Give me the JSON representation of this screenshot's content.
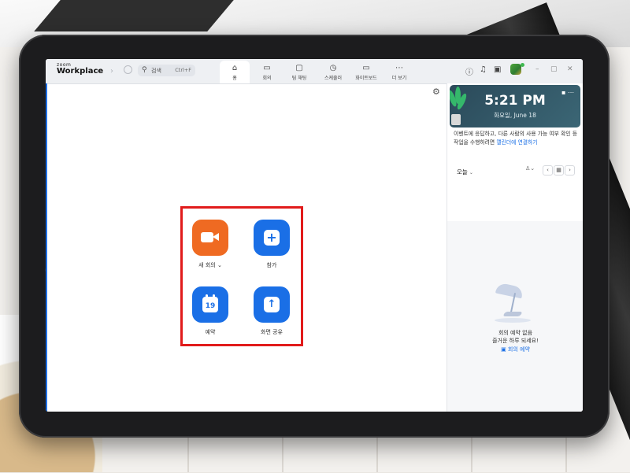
{
  "titlebar": {
    "logo_small": "zoom",
    "logo_big": "Workplace",
    "back_arrow": "‹",
    "forward_arrow": "›",
    "search_placeholder": "검색",
    "search_shortcut": "Ctrl+F"
  },
  "nav_tabs": [
    {
      "label": "홈",
      "icon": "home-icon"
    },
    {
      "label": "회의",
      "icon": "video-icon"
    },
    {
      "label": "팀 채팅",
      "icon": "chat-icon"
    },
    {
      "label": "스케줄러",
      "icon": "clock-icon"
    },
    {
      "label": "화이트보드",
      "icon": "whiteboard-icon"
    },
    {
      "label": "더 보기",
      "icon": "more-icon"
    }
  ],
  "window_controls": [
    "–",
    "▢",
    "✕"
  ],
  "main": {
    "actions": [
      {
        "label": "새 회의",
        "chevron": "⌄",
        "icon": "video-camera-icon",
        "color": "#ef6a22"
      },
      {
        "label": "참가",
        "icon": "plus-icon",
        "color": "#1a6fe6"
      },
      {
        "label": "예약",
        "icon": "calendar-icon",
        "day": "19",
        "color": "#1a6fe6"
      },
      {
        "label": "화면 공유",
        "icon": "share-up-arrow-icon",
        "color": "#1a6fe6"
      }
    ],
    "highlight_color": "#e11b1b"
  },
  "right_panel": {
    "time": "5:21 PM",
    "date": "화요일, June 18",
    "notice_text": "이벤트에 응답하고, 다른 사람의 사용 가능 여부 확인 등 작업을 수행하려면 ",
    "notice_link": "캘린더에 연결하기",
    "today_label": "오늘",
    "empty_line1": "회의 예약 없음",
    "empty_line2": "즐거운 하루 되세요!",
    "empty_link": "회의 예약"
  }
}
